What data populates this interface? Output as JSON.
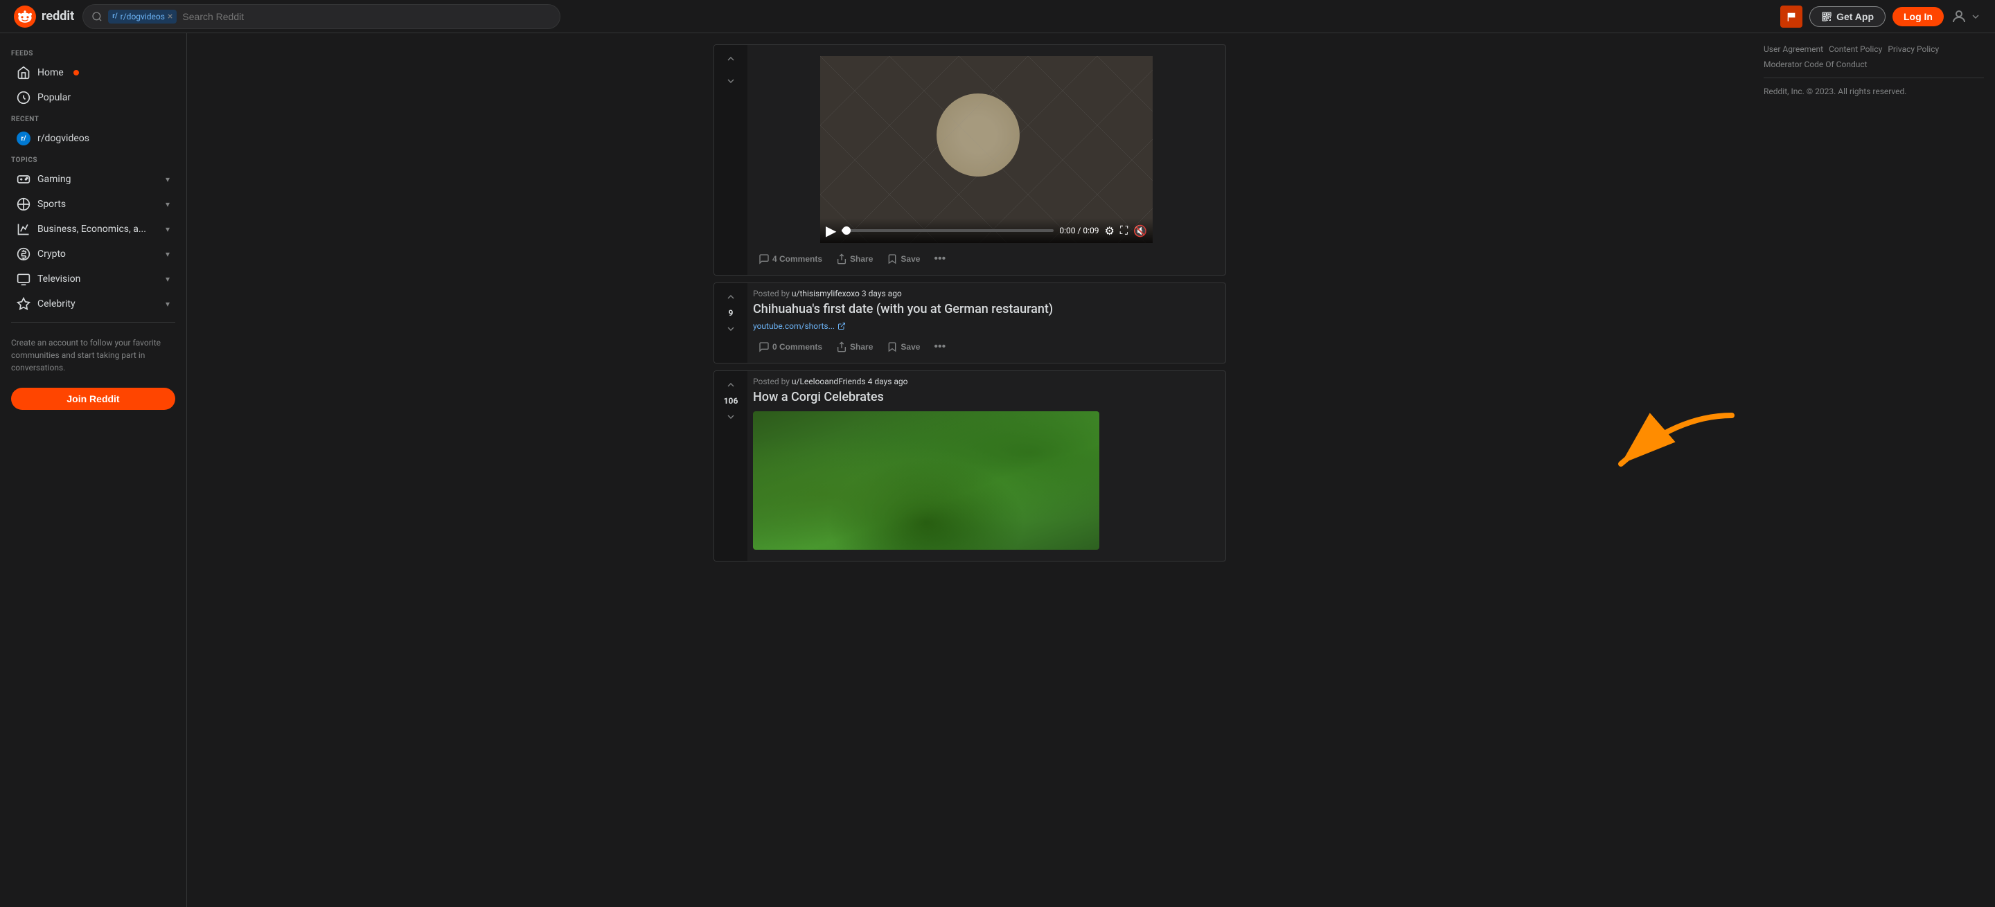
{
  "header": {
    "logo_text": "reddit",
    "search_placeholder": "Search Reddit",
    "search_tag": "r/dogvideos",
    "get_app_label": "Get App",
    "login_label": "Log In"
  },
  "sidebar": {
    "feeds_label": "FEEDS",
    "home_label": "Home",
    "popular_label": "Popular",
    "recent_label": "RECENT",
    "dogvideos_label": "r/dogvideos",
    "topics_label": "TOPICS",
    "items": [
      {
        "label": "Gaming"
      },
      {
        "label": "Sports"
      },
      {
        "label": "Business, Economics, a..."
      },
      {
        "label": "Crypto"
      },
      {
        "label": "Television"
      },
      {
        "label": "Celebrity"
      }
    ],
    "promo_text": "Create an account to follow your favorite communities and start taking part in conversations.",
    "join_label": "Join Reddit"
  },
  "posts": [
    {
      "id": "post1",
      "posted_by": "u/thisismylifexoxo",
      "time_ago": "3 days ago",
      "vote_count": "9",
      "title": "Chihuahua's first date (with you at German restaurant)",
      "link_text": "youtube.com/shorts...",
      "comments_count": "0 Comments",
      "share_label": "Share",
      "save_label": "Save"
    },
    {
      "id": "post2",
      "posted_by": "u/LeelooandFriends",
      "time_ago": "4 days ago",
      "vote_count": "106",
      "title": "How a Corgi Celebrates",
      "comments_count": "4 Comments",
      "share_label": "Share",
      "save_label": "Save"
    }
  ],
  "video": {
    "time_current": "0:00",
    "time_total": "0:09",
    "comments_count": "4 Comments",
    "share_label": "Share",
    "save_label": "Save"
  },
  "right_sidebar": {
    "links": [
      {
        "label": "User Agreement"
      },
      {
        "label": "Content Policy"
      },
      {
        "label": "Privacy Policy"
      },
      {
        "label": "Moderator Code Of Conduct"
      }
    ],
    "copyright": "Reddit, Inc. © 2023. All rights reserved."
  }
}
